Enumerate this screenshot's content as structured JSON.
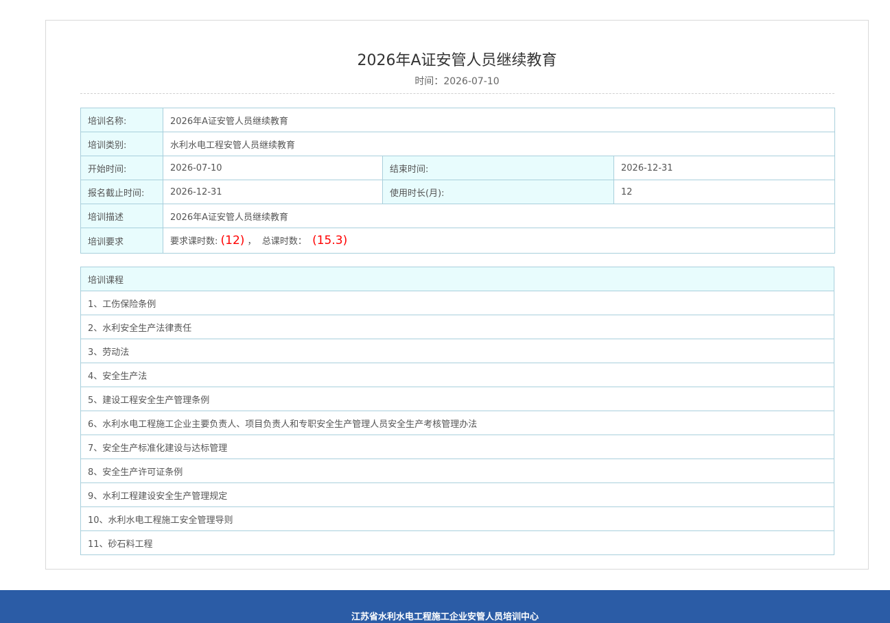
{
  "header": {
    "title": "2026年A证安管人员继续教育",
    "date_label": "时间：",
    "date_value": "2026-07-10"
  },
  "info": {
    "name_label": "培训名称:",
    "name_value": "2026年A证安管人员继续教育",
    "category_label": "培训类别:",
    "category_value": "水利水电工程安管人员继续教育",
    "start_label": "开始时间:",
    "start_value": "2026-07-10",
    "end_label": "结束时间:",
    "end_value": "2026-12-31",
    "deadline_label": "报名截止时间:",
    "deadline_value": "2026-12-31",
    "duration_label": "使用时长(月):",
    "duration_value": "12",
    "desc_label": "培训描述",
    "desc_value": "2026年A证安管人员继续教育",
    "req_label": "培训要求",
    "req_hours_prefix": "要求课时数: ",
    "req_hours_value": "(12)",
    "req_sep": " ，  总课时数：  ",
    "total_hours_value": "(15.3)"
  },
  "courses": {
    "header": "培训课程",
    "items": [
      "1、工伤保险条例",
      "2、水利安全生产法律责任",
      "3、劳动法",
      "4、安全生产法",
      "5、建设工程安全生产管理条例",
      "6、水利水电工程施工企业主要负责人、项目负责人和专职安全生产管理人员安全生产考核管理办法",
      "7、安全生产标准化建设与达标管理",
      "8、安全生产许可证条例",
      "9、水利工程建设安全生产管理规定",
      "10、水利水电工程施工安全管理导则",
      "11、砂石料工程"
    ]
  },
  "footer": {
    "text": "江苏省水利水电工程施工企业安管人员培训中心"
  },
  "colors": {
    "label_bg": "#e8fcfd",
    "border": "#a8cfdc",
    "highlight": "#ff0000",
    "footer_bg": "#2b5ca6"
  }
}
